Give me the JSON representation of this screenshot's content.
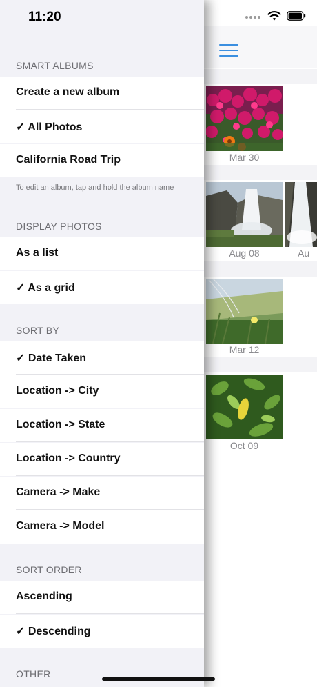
{
  "status_bar": {
    "time": "11:20"
  },
  "drawer": {
    "sections": [
      {
        "header": "SMART ALBUMS",
        "items": [
          {
            "label": "Create a new album"
          },
          {
            "label": "✓ All Photos"
          },
          {
            "label": "California Road Trip"
          }
        ],
        "footnote": "To edit an album, tap and hold the album name"
      },
      {
        "header": "DISPLAY PHOTOS",
        "items": [
          {
            "label": "As a list"
          },
          {
            "label": "✓ As a grid"
          }
        ]
      },
      {
        "header": "SORT BY",
        "items": [
          {
            "label": "✓ Date Taken"
          },
          {
            "label": "Location -> City"
          },
          {
            "label": "Location -> State"
          },
          {
            "label": "Location -> Country"
          },
          {
            "label": "Camera -> Make"
          },
          {
            "label": "Camera -> Model"
          }
        ]
      },
      {
        "header": "SORT ORDER",
        "items": [
          {
            "label": "Ascending"
          },
          {
            "label": "✓ Descending"
          }
        ]
      },
      {
        "header": "OTHER",
        "items": []
      }
    ]
  },
  "gallery": {
    "groups": [
      {
        "date_label": "Mar 30"
      },
      {
        "date_label": "Aug 08",
        "extra_label": "Au"
      },
      {
        "date_label": "Mar 12"
      },
      {
        "date_label": "Oct 09"
      }
    ]
  },
  "colors": {
    "accent": "#3b8fe0",
    "section_bg": "#f2f2f7",
    "header_text": "#6d6d72"
  }
}
